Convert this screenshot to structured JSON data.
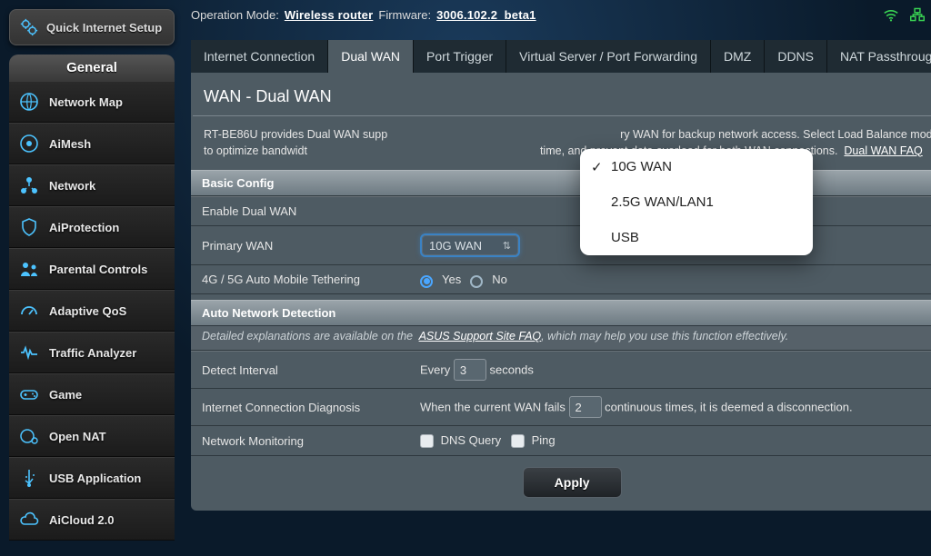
{
  "quick_setup_label": "Quick Internet Setup",
  "sidebar": {
    "header": "General",
    "items": [
      {
        "label": "Network Map"
      },
      {
        "label": "AiMesh"
      },
      {
        "label": "Network"
      },
      {
        "label": "AiProtection"
      },
      {
        "label": "Parental Controls"
      },
      {
        "label": "Adaptive QoS"
      },
      {
        "label": "Traffic Analyzer"
      },
      {
        "label": "Game"
      },
      {
        "label": "Open NAT"
      },
      {
        "label": "USB Application"
      },
      {
        "label": "AiCloud 2.0"
      }
    ]
  },
  "top": {
    "op_mode_label": "Operation Mode:",
    "op_mode_value": "Wireless router",
    "fw_label": "Firmware:",
    "fw_value": "3006.102.2_beta1"
  },
  "tabs": [
    "Internet Connection",
    "Dual WAN",
    "Port Trigger",
    "Virtual Server / Port Forwarding",
    "DMZ",
    "DDNS",
    "NAT Passthrough"
  ],
  "active_tab_index": 1,
  "page_title": "WAN - Dual WAN",
  "description_a": "RT-BE86U provides Dual WAN supp",
  "description_b": "ry WAN for backup network access. Select Load Balance mode to optimize bandwidt",
  "description_c": "time, and prevent data overload for both WAN connections.",
  "description_link": "Dual WAN FAQ",
  "basic": {
    "header": "Basic Config",
    "enable_label": "Enable Dual WAN",
    "primary_label": "Primary WAN",
    "primary_value": "10G WAN",
    "tether_label": "4G / 5G Auto Mobile Tethering",
    "yes": "Yes",
    "no": "No"
  },
  "auto": {
    "header": "Auto Network Detection",
    "sub_a": "Detailed explanations are available on the",
    "sub_link": "ASUS Support Site FAQ",
    "sub_b": ", which may help you use this function effectively.",
    "detect_label": "Detect Interval",
    "detect_pre": "Every",
    "detect_val": "3",
    "detect_post": "seconds",
    "diag_label": "Internet Connection Diagnosis",
    "diag_pre": "When the current WAN fails",
    "diag_val": "2",
    "diag_post": "continuous times, it is deemed a disconnection.",
    "mon_label": "Network Monitoring",
    "mon_dns": "DNS Query",
    "mon_ping": "Ping"
  },
  "apply_label": "Apply",
  "dropdown": {
    "options": [
      "10G WAN",
      "2.5G WAN/LAN1",
      "USB"
    ],
    "selected_index": 0
  },
  "colors": {
    "accent": "#4aa6ff",
    "tab_active": "#4e5b63"
  }
}
